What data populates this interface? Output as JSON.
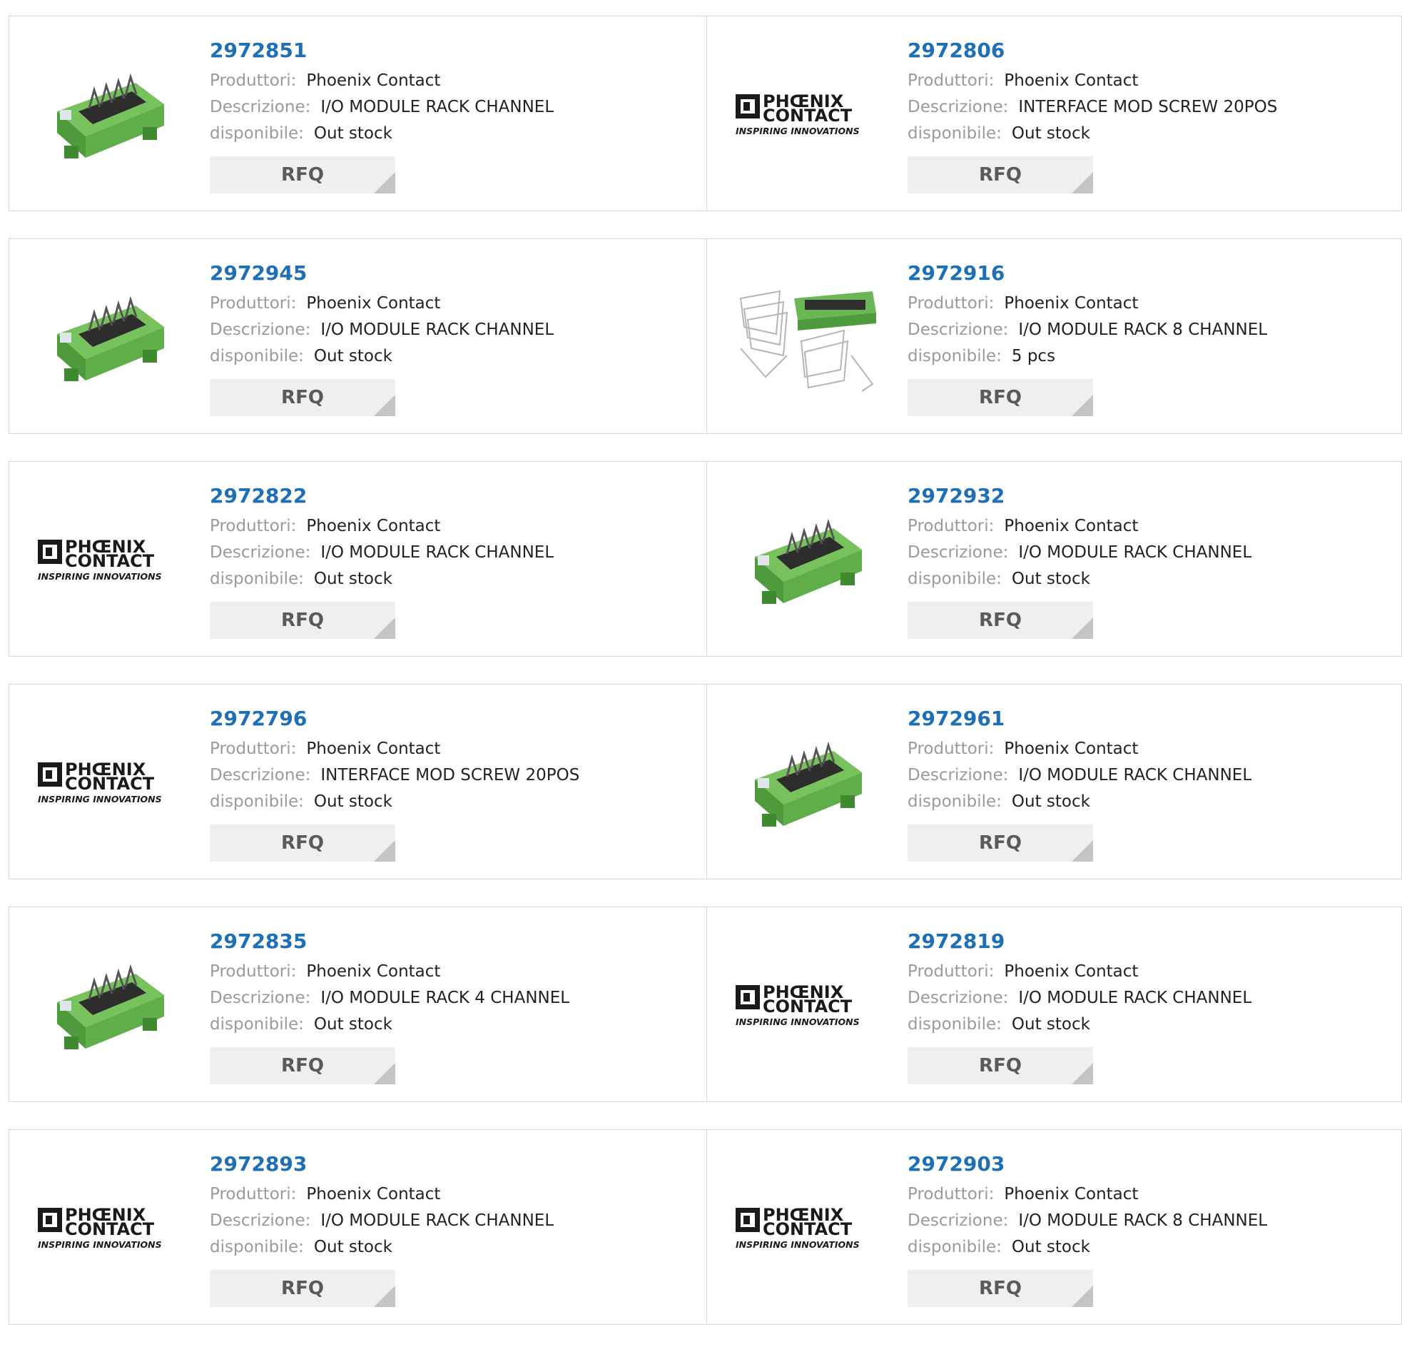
{
  "labels": {
    "manufacturer": "Produttori:",
    "description": "Descrizione:",
    "availability": "disponibile:",
    "rfq": "RFQ"
  },
  "logo_text": {
    "top": "PHŒNIX",
    "bottom": "CONTACT",
    "tagline": "INSPIRING INNOVATIONS"
  },
  "colors": {
    "link": "#1f6fb5",
    "module_green": "#5fae4a",
    "button_bg": "#efefef"
  },
  "products": [
    {
      "part": "2972851",
      "manufacturer": "Phoenix Contact",
      "description": "I/O MODULE RACK CHANNEL",
      "availability": "Out stock",
      "image": "module-image"
    },
    {
      "part": "2972806",
      "manufacturer": "Phoenix Contact",
      "description": "INTERFACE MOD SCREW 20POS",
      "availability": "Out stock",
      "image": "phoenix-logo"
    },
    {
      "part": "2972945",
      "manufacturer": "Phoenix Contact",
      "description": "I/O MODULE RACK CHANNEL",
      "availability": "Out stock",
      "image": "module-image"
    },
    {
      "part": "2972916",
      "manufacturer": "Phoenix Contact",
      "description": "I/O MODULE RACK 8 CHANNEL",
      "availability": "5 pcs",
      "image": "module-wires-image"
    },
    {
      "part": "2972822",
      "manufacturer": "Phoenix Contact",
      "description": "I/O MODULE RACK CHANNEL",
      "availability": "Out stock",
      "image": "phoenix-logo"
    },
    {
      "part": "2972932",
      "manufacturer": "Phoenix Contact",
      "description": "I/O MODULE RACK CHANNEL",
      "availability": "Out stock",
      "image": "module-image"
    },
    {
      "part": "2972796",
      "manufacturer": "Phoenix Contact",
      "description": "INTERFACE MOD SCREW 20POS",
      "availability": "Out stock",
      "image": "phoenix-logo"
    },
    {
      "part": "2972961",
      "manufacturer": "Phoenix Contact",
      "description": "I/O MODULE RACK CHANNEL",
      "availability": "Out stock",
      "image": "module-image"
    },
    {
      "part": "2972835",
      "manufacturer": "Phoenix Contact",
      "description": "I/O MODULE RACK 4 CHANNEL",
      "availability": "Out stock",
      "image": "module-image"
    },
    {
      "part": "2972819",
      "manufacturer": "Phoenix Contact",
      "description": "I/O MODULE RACK CHANNEL",
      "availability": "Out stock",
      "image": "phoenix-logo"
    },
    {
      "part": "2972893",
      "manufacturer": "Phoenix Contact",
      "description": "I/O MODULE RACK CHANNEL",
      "availability": "Out stock",
      "image": "phoenix-logo"
    },
    {
      "part": "2972903",
      "manufacturer": "Phoenix Contact",
      "description": "I/O MODULE RACK 8 CHANNEL",
      "availability": "Out stock",
      "image": "phoenix-logo"
    }
  ]
}
